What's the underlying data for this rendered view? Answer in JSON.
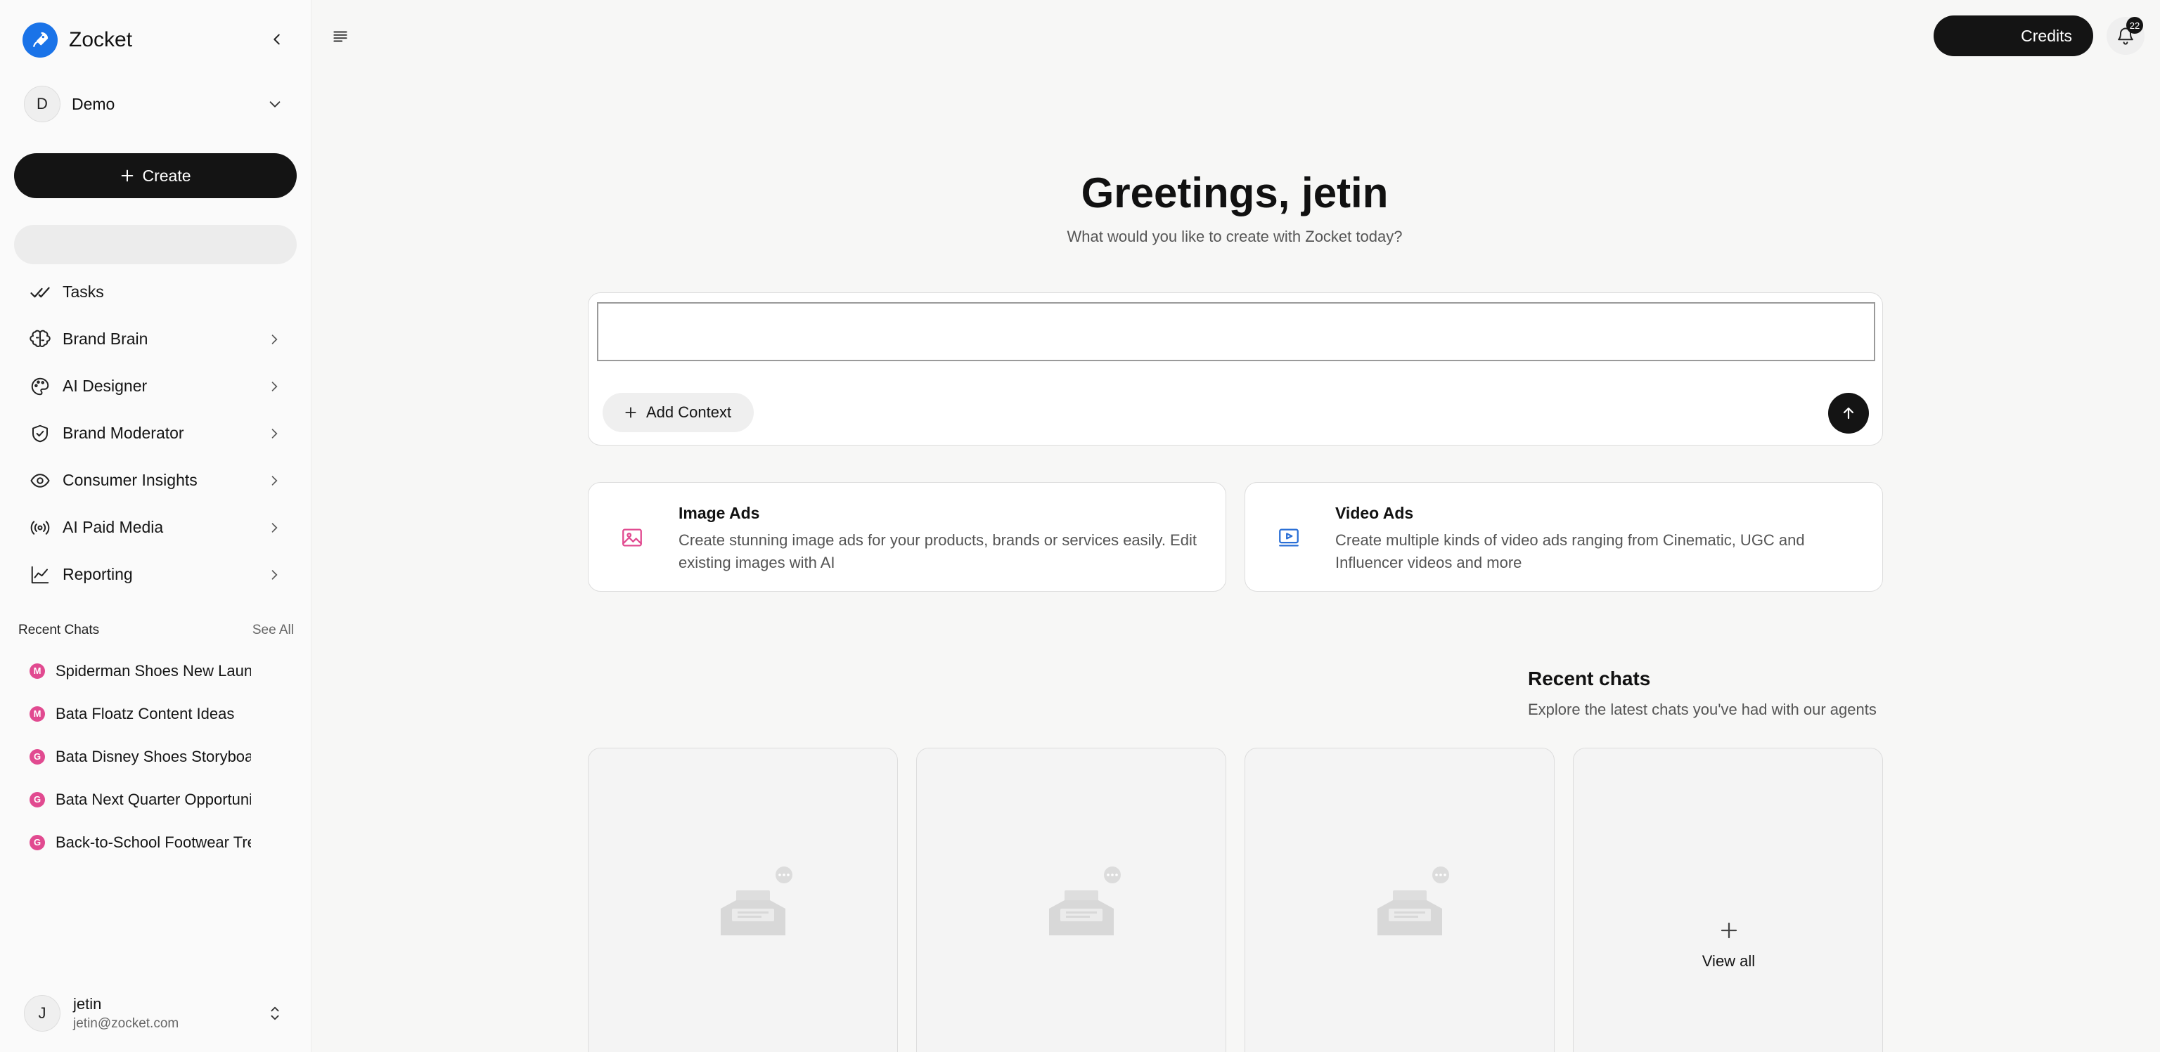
{
  "brand": {
    "name": "Zocket"
  },
  "workspace": {
    "initial": "D",
    "name": "Demo"
  },
  "sidebar": {
    "create_label": "Create",
    "items": [
      {
        "label": "Tasks",
        "icon": "double-check-icon",
        "has_chevron": false
      },
      {
        "label": "Brand Brain",
        "icon": "brain-icon",
        "has_chevron": true
      },
      {
        "label": "AI Designer",
        "icon": "palette-icon",
        "has_chevron": true
      },
      {
        "label": "Brand Moderator",
        "icon": "shield-check-icon",
        "has_chevron": true
      },
      {
        "label": "Consumer Insights",
        "icon": "eye-icon",
        "has_chevron": true
      },
      {
        "label": "AI Paid Media",
        "icon": "broadcast-icon",
        "has_chevron": true
      },
      {
        "label": "Reporting",
        "icon": "line-chart-icon",
        "has_chevron": true
      }
    ],
    "recent_title": "Recent Chats",
    "see_all": "See All",
    "recent": [
      {
        "badge": "M",
        "title": "Spiderman Shoes New Launch"
      },
      {
        "badge": "M",
        "title": "Bata Floatz Content Ideas"
      },
      {
        "badge": "G",
        "title": "Bata Disney Shoes Storyboard"
      },
      {
        "badge": "G",
        "title": "Bata Next Quarter Opportunities"
      },
      {
        "badge": "G",
        "title": "Back-to-School Footwear Trends"
      }
    ]
  },
  "user": {
    "initial": "J",
    "name": "jetin",
    "email": "jetin@zocket.com"
  },
  "header": {
    "credits_label": "Credits",
    "notification_count": "22"
  },
  "main": {
    "greeting": "Greetings, jetin",
    "subtitle": "What would you like to create with Zocket today?",
    "prompt_placeholder": "",
    "add_context": "Add Context",
    "features": [
      {
        "title": "Image Ads",
        "desc": "Create stunning image ads for your products, brands or services easily. Edit existing images with AI",
        "icon": "image-icon",
        "color": "#e14a90"
      },
      {
        "title": "Video Ads",
        "desc": "Create multiple kinds of video ads ranging from Cinematic, UGC and Influencer videos and more",
        "icon": "video-icon",
        "color": "#2a6fd6"
      }
    ],
    "recent_title": "Recent chats",
    "recent_subtitle": "Explore the latest chats you've had with our agents",
    "view_all": "View all"
  },
  "colors": {
    "accent_dark": "#141414",
    "badge_pink": "#e14a90",
    "brand_blue": "#1a73e8"
  }
}
